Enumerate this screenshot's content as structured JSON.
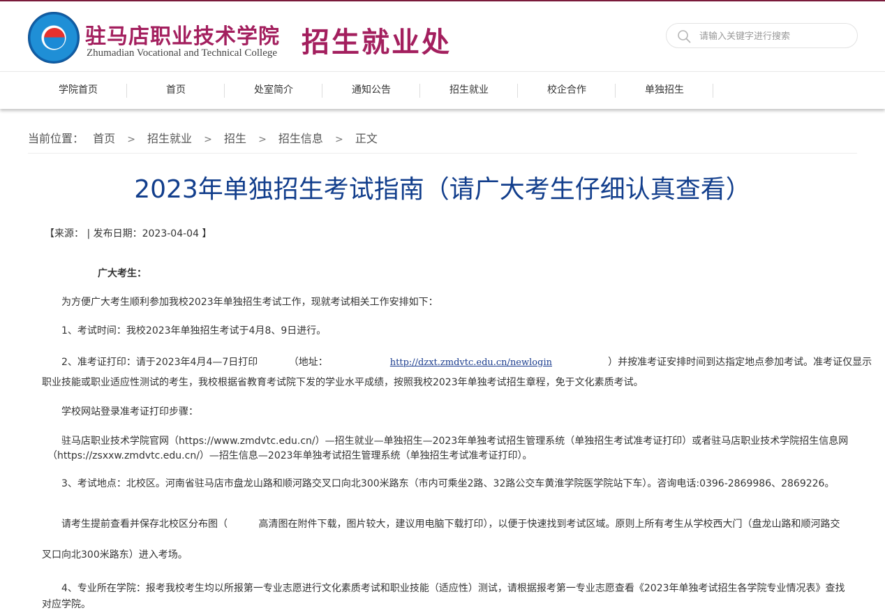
{
  "header": {
    "college_name_cn": "驻马店职业技术学院",
    "college_name_en": "Zhumadian Vocational and Technical College",
    "dept_title": "招生就业处",
    "search_placeholder": "请输入关键字进行搜索",
    "brand_color": "#a31f5e"
  },
  "nav": {
    "items": [
      "学院首页",
      "首页",
      "处室简介",
      "通知公告",
      "招生就业",
      "校企合作",
      "单独招生"
    ]
  },
  "breadcrumb": {
    "label": "当前位置：",
    "items": [
      "首页",
      "招生就业",
      "招生",
      "招生信息",
      "正文"
    ]
  },
  "article": {
    "title": "2023年单独招生考试指南（请广大考生仔细认真查看）",
    "meta": "【来源：  | 发布日期：2023-04-04 】",
    "greeting": "广大考生：",
    "p1": "为方便广大考生顺利参加我校2023年单独招生考试工作，现就考试相关工作安排如下：",
    "p2": "1、考试时间：我校2023年单独招生考试于4月8、9日进行。",
    "p3_a": "2、准考证打印：请于2023年4月4—7日打印          （地址：                    ",
    "p3_link": "http://dzxt.zmdvtc.edu.cn/newlogin",
    "p3_b": "                  ）并按准考证安排时间到达指定地点参加考试。准考证仅显示",
    "p3_c": "职业技能或职业适应性测试的考生，我校根据省教育考试院下发的学业水平成绩，按照我校2023年单独考试招生章程，免于文化素质考试。",
    "p4": "学校网站登录准考证打印步骤：",
    "p5": "驻马店职业技术学院官网（https://www.zmdvtc.edu.cn/）—招生就业—单独招生—2023年单独考试招生管理系统（单独招生考试准考证打印）或者驻马店职业技术学院招生信息网",
    "p5b": "（https://zsxxw.zmdvtc.edu.cn/）—招生信息—2023年单独考试招生管理系统（单独招生考试准考证打印）。",
    "p6": "3、考试地点：北校区。河南省驻马店市盘龙山路和顺河路交叉口向北300米路东（市内可乘坐2路、32路公交车黄淮学院医学院站下车）。咨询电话:0396-2869986、2869226。",
    "p7": "请考生提前查看并保存北校区分布图（          高清图在附件下载，图片较大，建议用电脑下载打印），以便于快速找到考试区域。原则上所有考生从学校西大门（盘龙山路和顺河路交",
    "p7b": "叉口向北300米路东）进入考场。",
    "p8": "4、专业所在学院：报考我校考生均以所报第一专业志愿进行文化素质考试和职业技能（适应性）测试，请根据报考第一专业志愿查看《2023年单独考试招生各学院专业情况表》查找",
    "p8b": "对应学院。"
  }
}
